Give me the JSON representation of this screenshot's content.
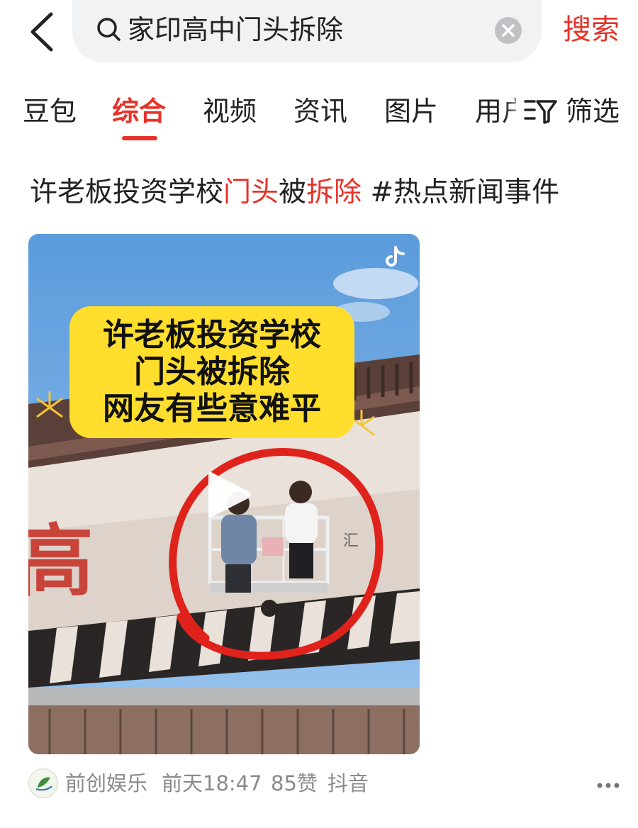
{
  "header": {
    "search_query": "家印高中门头拆除",
    "search_button": "搜索"
  },
  "tabs": [
    {
      "label": "豆包"
    },
    {
      "label": "综合",
      "active": true
    },
    {
      "label": "视频"
    },
    {
      "label": "资讯"
    },
    {
      "label": "图片"
    },
    {
      "label": "用户"
    }
  ],
  "filter": {
    "label": "筛选"
  },
  "result": {
    "title_parts": [
      "许老板投资学校",
      "门头",
      "被",
      "拆除",
      " #热点新闻事件"
    ],
    "video": {
      "overlay_lines": [
        "许老板投资学校",
        "门头被拆除",
        "网友有些意难平"
      ],
      "sign_char": "高",
      "watermark": "",
      "platform_icon": "tiktok-icon"
    },
    "meta": {
      "author": "前创娱乐",
      "time": "前天18:47",
      "likes": "85赞",
      "source": "抖音"
    }
  },
  "colors": {
    "accent": "#e5332a",
    "overlay_yellow": "#ffde2e",
    "search_bg": "#f1f2f4",
    "meta_gray": "#8a8a8a"
  }
}
